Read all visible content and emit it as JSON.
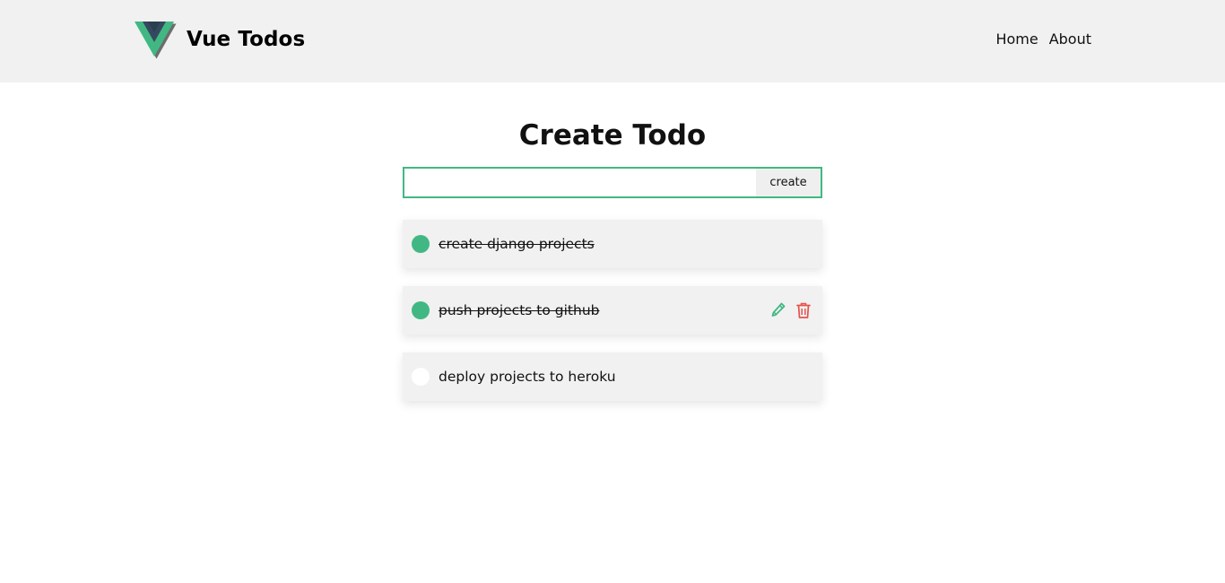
{
  "header": {
    "brand_title": "Vue Todos",
    "nav": [
      {
        "label": "Home"
      },
      {
        "label": "About"
      }
    ]
  },
  "main": {
    "title": "Create Todo",
    "create_input": {
      "value": "",
      "placeholder": ""
    },
    "create_button_label": "create",
    "todos": [
      {
        "text": "create django projects",
        "completed": true
      },
      {
        "text": "push projects to github",
        "completed": true,
        "show_actions": true
      },
      {
        "text": "deploy projects to heroku",
        "completed": false
      }
    ]
  },
  "colors": {
    "accent": "#41b883",
    "brand_dark": "#35495e",
    "delete": "#e5534b",
    "header_bg": "#f1f1f1"
  },
  "icons": [
    "vue-logo-icon",
    "pencil-icon",
    "trash-icon",
    "check-circle-icon"
  ]
}
